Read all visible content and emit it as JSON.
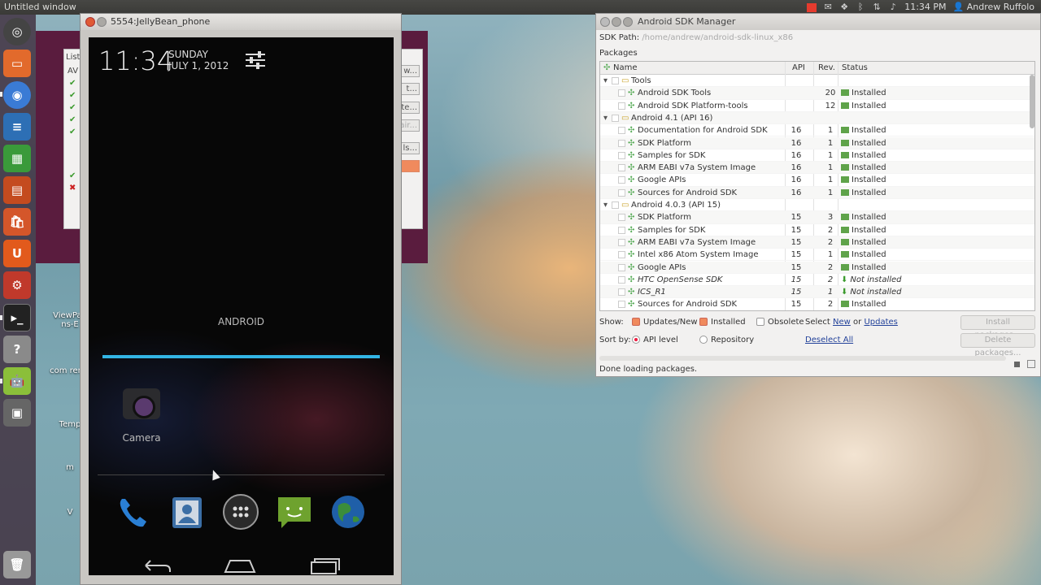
{
  "panel": {
    "window_title": "Untitled window",
    "time": "11:34 PM",
    "user": "Andrew Ruffolo"
  },
  "launcher": {
    "items": [
      "dash-icon",
      "files-icon",
      "chromium-icon",
      "writer-icon",
      "calc-icon",
      "impress-icon",
      "software-center-icon",
      "ubuntu-one-icon",
      "settings-icon",
      "terminal-icon",
      "help-icon",
      "android-sdk-icon",
      "workspace-icon",
      "trash-icon"
    ]
  },
  "desktop": {
    "labels": [
      "ViewPag ns-E",
      "com renal",
      "Temp",
      "m",
      "V"
    ]
  },
  "avd": {
    "partial_title": "List",
    "col": "AV",
    "btns": [
      "w...",
      "t...",
      "te...",
      "air...",
      "ls...",
      ""
    ]
  },
  "emulator": {
    "title": "5554:JellyBean_phone",
    "time": "11:34",
    "day": "SUNDAY",
    "date": "JULY 1, 2012",
    "loading": "ANDROID",
    "camera_label": "Camera"
  },
  "sdk": {
    "title": "Android SDK Manager",
    "path_label": "SDK Path:",
    "path_value": "/home/andrew/android-sdk-linux_x86",
    "packages_label": "Packages",
    "cols": {
      "name": "Name",
      "api": "API",
      "rev": "Rev.",
      "status": "Status"
    },
    "rows": [
      {
        "name": "Tools",
        "api": "",
        "rev": "",
        "status": "",
        "indent": 1,
        "group": true
      },
      {
        "name": "Android SDK Tools",
        "api": "",
        "rev": "20",
        "status": "Installed",
        "indent": 2
      },
      {
        "name": "Android SDK Platform-tools",
        "api": "",
        "rev": "12",
        "status": "Installed",
        "indent": 2
      },
      {
        "name": "Android 4.1 (API 16)",
        "api": "",
        "rev": "",
        "status": "",
        "indent": 1,
        "group": true
      },
      {
        "name": "Documentation for Android SDK",
        "api": "16",
        "rev": "1",
        "status": "Installed",
        "indent": 2
      },
      {
        "name": "SDK Platform",
        "api": "16",
        "rev": "1",
        "status": "Installed",
        "indent": 2
      },
      {
        "name": "Samples for SDK",
        "api": "16",
        "rev": "1",
        "status": "Installed",
        "indent": 2
      },
      {
        "name": "ARM EABI v7a System Image",
        "api": "16",
        "rev": "1",
        "status": "Installed",
        "indent": 2
      },
      {
        "name": "Google APIs",
        "api": "16",
        "rev": "1",
        "status": "Installed",
        "indent": 2
      },
      {
        "name": "Sources for Android SDK",
        "api": "16",
        "rev": "1",
        "status": "Installed",
        "indent": 2
      },
      {
        "name": "Android 4.0.3 (API 15)",
        "api": "",
        "rev": "",
        "status": "",
        "indent": 1,
        "group": true
      },
      {
        "name": "SDK Platform",
        "api": "15",
        "rev": "3",
        "status": "Installed",
        "indent": 2
      },
      {
        "name": "Samples for SDK",
        "api": "15",
        "rev": "2",
        "status": "Installed",
        "indent": 2
      },
      {
        "name": "ARM EABI v7a System Image",
        "api": "15",
        "rev": "2",
        "status": "Installed",
        "indent": 2
      },
      {
        "name": "Intel x86 Atom System Image",
        "api": "15",
        "rev": "1",
        "status": "Installed",
        "indent": 2
      },
      {
        "name": "Google APIs",
        "api": "15",
        "rev": "2",
        "status": "Installed",
        "indent": 2
      },
      {
        "name": "HTC OpenSense SDK",
        "api": "15",
        "rev": "2",
        "status": "Not installed",
        "indent": 2,
        "ni": true
      },
      {
        "name": "ICS_R1",
        "api": "15",
        "rev": "1",
        "status": "Not installed",
        "indent": 2,
        "ni": true
      },
      {
        "name": "Sources for Android SDK",
        "api": "15",
        "rev": "2",
        "status": "Installed",
        "indent": 2
      }
    ],
    "show_label": "Show:",
    "updates_new": "Updates/New",
    "installed": "Installed",
    "obsolete": "Obsolete",
    "select_label": "Select",
    "new_link": "New",
    "or": "or",
    "updates_link": "Updates",
    "sortby_label": "Sort by:",
    "api_level": "API level",
    "repository": "Repository",
    "deselect_all": "Deselect All",
    "install_btn": "Install packages...",
    "delete_btn": "Delete packages...",
    "status_text": "Done loading packages."
  }
}
